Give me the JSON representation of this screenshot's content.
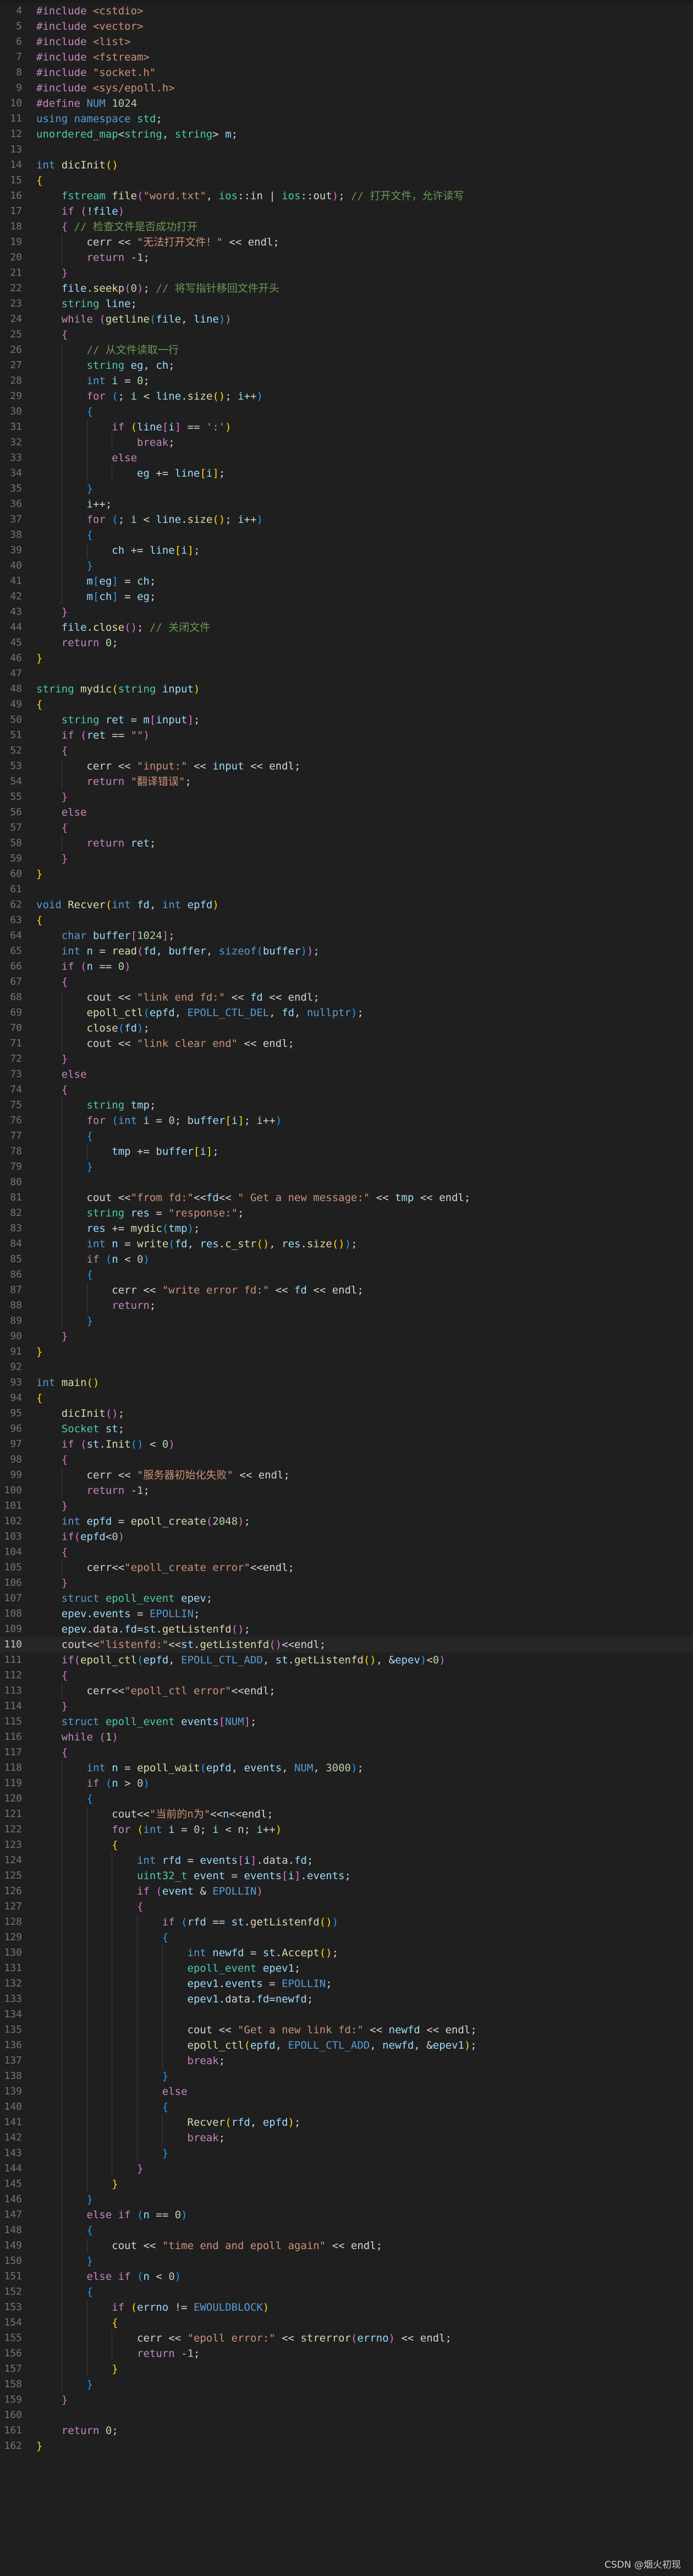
{
  "editor": {
    "first_line_number": 4,
    "active_line_number": 110,
    "lines": [
      "#include <cstdio>",
      "#include <vector>",
      "#include <list>",
      "#include <fstream>",
      "#include \"socket.h\"",
      "#include <sys/epoll.h>",
      "#define NUM 1024",
      "using namespace std;",
      "unordered_map<string, string> m;",
      "",
      "int dicInit()",
      "{",
      "    fstream file(\"word.txt\", ios::in | ios::out); // 打开文件，允许读写",
      "    if (!file)",
      "    { // 检查文件是否成功打开",
      "        cerr << \"无法打开文件！\" << endl;",
      "        return -1;",
      "    }",
      "    file.seekp(0); // 将写指针移回文件开头",
      "    string line;",
      "    while (getline(file, line))",
      "    {",
      "        // 从文件读取一行",
      "        string eg, ch;",
      "        int i = 0;",
      "        for (; i < line.size(); i++)",
      "        {",
      "            if (line[i] == ':')",
      "                break;",
      "            else",
      "                eg += line[i];",
      "        }",
      "        i++;",
      "        for (; i < line.size(); i++)",
      "        {",
      "            ch += line[i];",
      "        }",
      "        m[eg] = ch;",
      "        m[ch] = eg;",
      "    }",
      "    file.close(); // 关闭文件",
      "    return 0;",
      "}",
      "",
      "string mydic(string input)",
      "{",
      "    string ret = m[input];",
      "    if (ret == \"\")",
      "    {",
      "        cerr << \"input:\" << input << endl;",
      "        return \"翻译错误\";",
      "    }",
      "    else",
      "    {",
      "        return ret;",
      "    }",
      "}",
      "",
      "void Recver(int fd, int epfd)",
      "{",
      "    char buffer[1024];",
      "    int n = read(fd, buffer, sizeof(buffer));",
      "    if (n == 0)",
      "    {",
      "        cout << \"link end fd:\" << fd << endl;",
      "        epoll_ctl(epfd, EPOLL_CTL_DEL, fd, nullptr);",
      "        close(fd);",
      "        cout << \"link clear end\" << endl;",
      "    }",
      "    else",
      "    {",
      "        string tmp;",
      "        for (int i = 0; buffer[i]; i++)",
      "        {",
      "            tmp += buffer[i];",
      "        }",
      "",
      "        cout <<\"from fd:\"<<fd<< \" Get a new message:\" << tmp << endl;",
      "        string res = \"response:\";",
      "        res += mydic(tmp);",
      "        int n = write(fd, res.c_str(), res.size());",
      "        if (n < 0)",
      "        {",
      "            cerr << \"write error fd:\" << fd << endl;",
      "            return;",
      "        }",
      "    }",
      "}",
      "",
      "int main()",
      "{",
      "    dicInit();",
      "    Socket st;",
      "    if (st.Init() < 0)",
      "    {",
      "        cerr << \"服务器初始化失败\" << endl;",
      "        return -1;",
      "    }",
      "    int epfd = epoll_create(2048);",
      "    if(epfd<0)",
      "    {",
      "        cerr<<\"epoll_create error\"<<endl;",
      "    }",
      "    struct epoll_event epev;",
      "    epev.events = EPOLLIN;",
      "    epev.data.fd=st.getListenfd();",
      "    cout<<\"listenfd:\"<<st.getListenfd()<<endl;",
      "    if(epoll_ctl(epfd, EPOLL_CTL_ADD, st.getListenfd(), &epev)<0)",
      "    {",
      "        cerr<<\"epoll_ctl error\"<<endl;",
      "    }",
      "    struct epoll_event events[NUM];",
      "    while (1)",
      "    {",
      "        int n = epoll_wait(epfd, events, NUM, 3000);",
      "        if (n > 0)",
      "        {",
      "            cout<<\"当前的n为\"<<n<<endl;",
      "            for (int i = 0; i < n; i++)",
      "            {",
      "                int rfd = events[i].data.fd;",
      "                uint32_t event = events[i].events;",
      "                if (event & EPOLLIN)",
      "                {",
      "                    if (rfd == st.getListenfd())",
      "                    {",
      "                        int newfd = st.Accept();",
      "                        epoll_event epev1;",
      "                        epev1.events = EPOLLIN;",
      "                        epev1.data.fd=newfd;",
      "",
      "                        cout << \"Get a new link fd:\" << newfd << endl;",
      "                        epoll_ctl(epfd, EPOLL_CTL_ADD, newfd, &epev1);",
      "                        break;",
      "                    }",
      "                    else",
      "                    {",
      "                        Recver(rfd, epfd);",
      "                        break;",
      "                    }",
      "                }",
      "            }",
      "        }",
      "        else if (n == 0)",
      "        {",
      "            cout << \"time end and epoll again\" << endl;",
      "        }",
      "        else if (n < 0)",
      "        {",
      "            if (errno != EWOULDBLOCK)",
      "            {",
      "                cerr << \"epoll error:\" << strerror(errno) << endl;",
      "                return -1;",
      "            }",
      "        }",
      "    }",
      "",
      "    return 0;",
      "}"
    ]
  },
  "watermark": "CSDN @烟火初现",
  "colors": {
    "background": "#1f1f1f",
    "keyword": "#569cd6",
    "control": "#c586c0",
    "type": "#4ec9b0",
    "function": "#dcdcaa",
    "string": "#ce9178",
    "comment": "#6a9955",
    "number": "#b5cea8",
    "variable": "#9cdcfe"
  }
}
